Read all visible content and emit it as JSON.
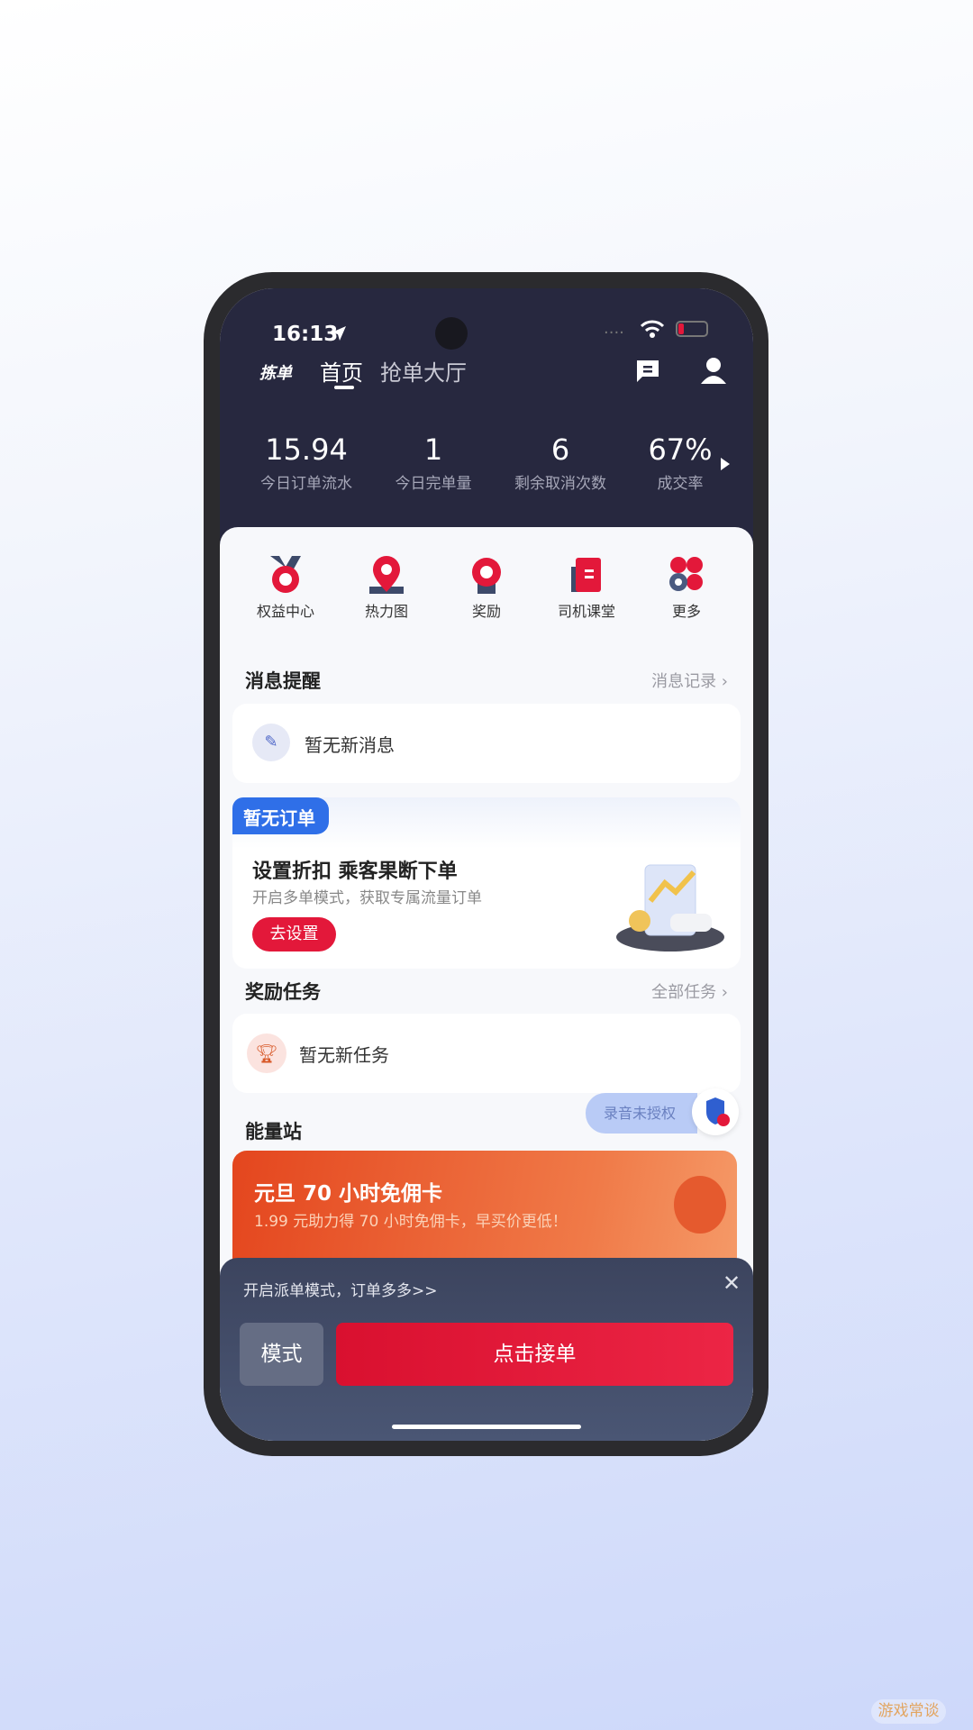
{
  "status": {
    "time": "16:13",
    "signal": "....",
    "battery_low": true
  },
  "nav": {
    "logo": "拣单",
    "tabs": [
      {
        "label": "首页",
        "active": true
      },
      {
        "label": "抢单大厅",
        "active": false
      }
    ],
    "icons": [
      "message-icon",
      "user-icon"
    ]
  },
  "stats": [
    {
      "value": "15.94",
      "label": "今日订单流水"
    },
    {
      "value": "1",
      "label": "今日完单量"
    },
    {
      "value": "6",
      "label": "剩余取消次数"
    },
    {
      "value": "67%",
      "label": "成交率"
    }
  ],
  "shortcuts": [
    {
      "label": "权益中心",
      "icon": "medal-icon"
    },
    {
      "label": "热力图",
      "icon": "map-pin-icon"
    },
    {
      "label": "奖励",
      "icon": "award-icon"
    },
    {
      "label": "司机课堂",
      "icon": "book-icon"
    },
    {
      "label": "更多",
      "icon": "more-icon"
    }
  ],
  "messages": {
    "title": "消息提醒",
    "link": "消息记录",
    "empty": "暂无新消息"
  },
  "order": {
    "badge": "暂无订单",
    "title": "设置折扣 乘客果断下单",
    "subtitle": "开启多单模式，获取专属流量订单",
    "button": "去设置"
  },
  "tasks": {
    "title": "奖励任务",
    "link": "全部任务",
    "empty": "暂无新任务"
  },
  "energy": {
    "title": "能量站",
    "banner_title": "元旦 70 小时免佣卡",
    "banner_sub": "1.99 元助力得 70 小时免佣卡，早买价更低！"
  },
  "recording": {
    "label": "录音未授权"
  },
  "sheet": {
    "tip": "开启派单模式，订单多多>>",
    "mode": "模式",
    "accept": "点击接单"
  },
  "watermark": "游戏常谈",
  "colors": {
    "accent": "#e3183a",
    "header": "#27283f",
    "badge": "#2f6fe8",
    "banner": "#ee5a2a"
  }
}
